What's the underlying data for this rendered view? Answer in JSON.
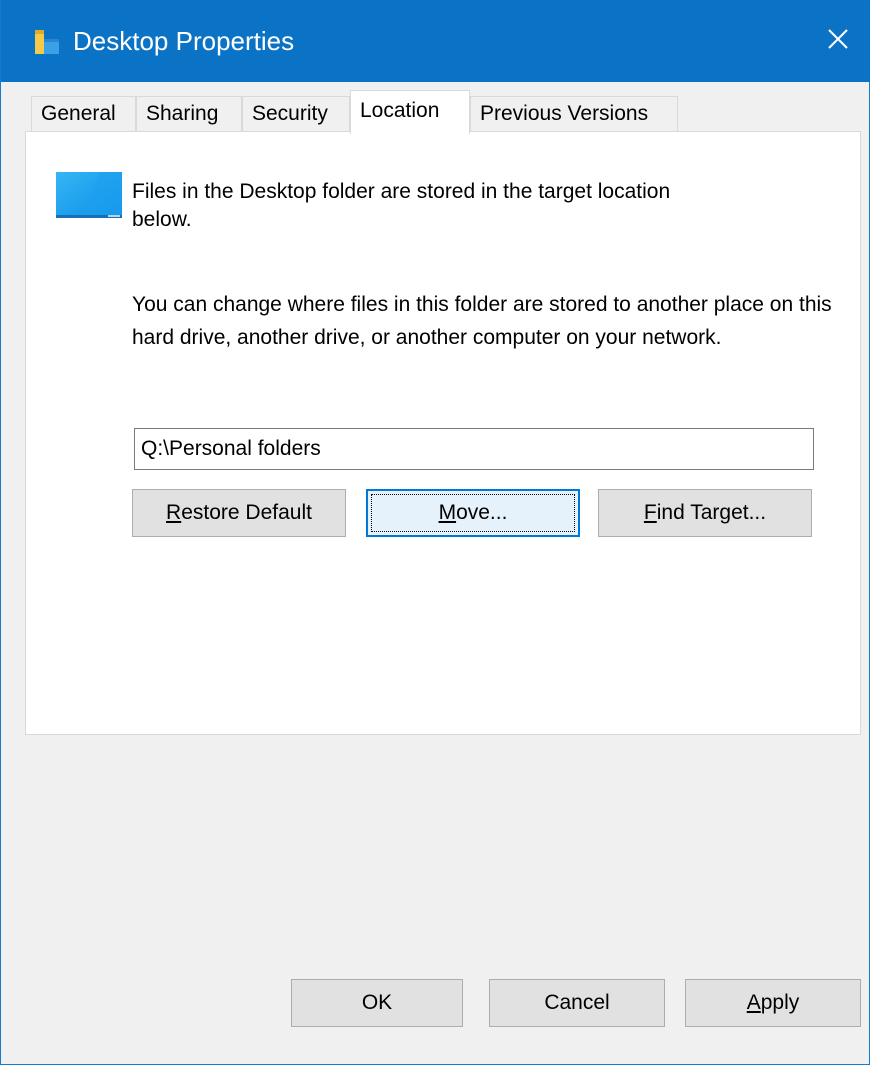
{
  "window": {
    "title": "Desktop Properties",
    "title_icon": "folder-icon",
    "close_icon": "close-icon",
    "accent": "#0b73c6"
  },
  "tabs": [
    {
      "label": "General",
      "active": false
    },
    {
      "label": "Sharing",
      "active": false
    },
    {
      "label": "Security",
      "active": false
    },
    {
      "label": "Location",
      "active": true
    },
    {
      "label": "Previous Versions",
      "active": false
    }
  ],
  "location": {
    "folder_icon": "desktop-folder-icon",
    "info": "Files in the Desktop folder are stored in the target location below.",
    "description": "You can change where files in this folder are stored to another place on this hard drive, another drive, or another computer on your network.",
    "path_value": "Q:\\Personal folders",
    "restore_default": {
      "accel": "R",
      "rest": "estore Default"
    },
    "move": {
      "accel": "M",
      "rest": "ove..."
    },
    "find_target": {
      "accel": "F",
      "rest": "ind Target..."
    }
  },
  "footer": {
    "ok": "OK",
    "cancel": "Cancel",
    "apply": {
      "accel": "A",
      "rest": "pply"
    }
  }
}
